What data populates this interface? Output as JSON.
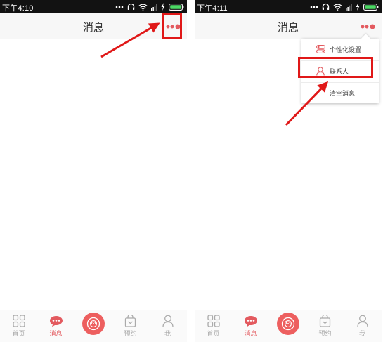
{
  "colors": {
    "status_bar": "#121212",
    "accent": "#e35a5f",
    "annotation_red": "#e01818",
    "battery_green": "#4cd964"
  },
  "screens": [
    {
      "status": {
        "time": "下午4:10"
      },
      "header": {
        "title": "消息",
        "more_icon": "more-dots-icon"
      },
      "tabs": [
        {
          "label": "首页",
          "icon": "grid-icon"
        },
        {
          "label": "消息",
          "icon": "chat-icon",
          "active": true
        },
        {
          "label": "",
          "icon": "center-disc-icon"
        },
        {
          "label": "预约",
          "icon": "bag-icon"
        },
        {
          "label": "我",
          "icon": "person-icon"
        }
      ]
    },
    {
      "status": {
        "time": "下午4:11"
      },
      "header": {
        "title": "消息",
        "more_icon": "more-dots-icon"
      },
      "menu": {
        "items": [
          {
            "label": "个性化设置",
            "icon": "settings-toggle-icon"
          },
          {
            "label": "联系人",
            "icon": "contact-person-icon"
          },
          {
            "label": "清空消息",
            "icon": ""
          }
        ]
      },
      "tabs": [
        {
          "label": "首页",
          "icon": "grid-icon"
        },
        {
          "label": "消息",
          "icon": "chat-icon",
          "active": true
        },
        {
          "label": "",
          "icon": "center-disc-icon"
        },
        {
          "label": "预约",
          "icon": "bag-icon"
        },
        {
          "label": "我",
          "icon": "person-icon"
        }
      ]
    }
  ]
}
